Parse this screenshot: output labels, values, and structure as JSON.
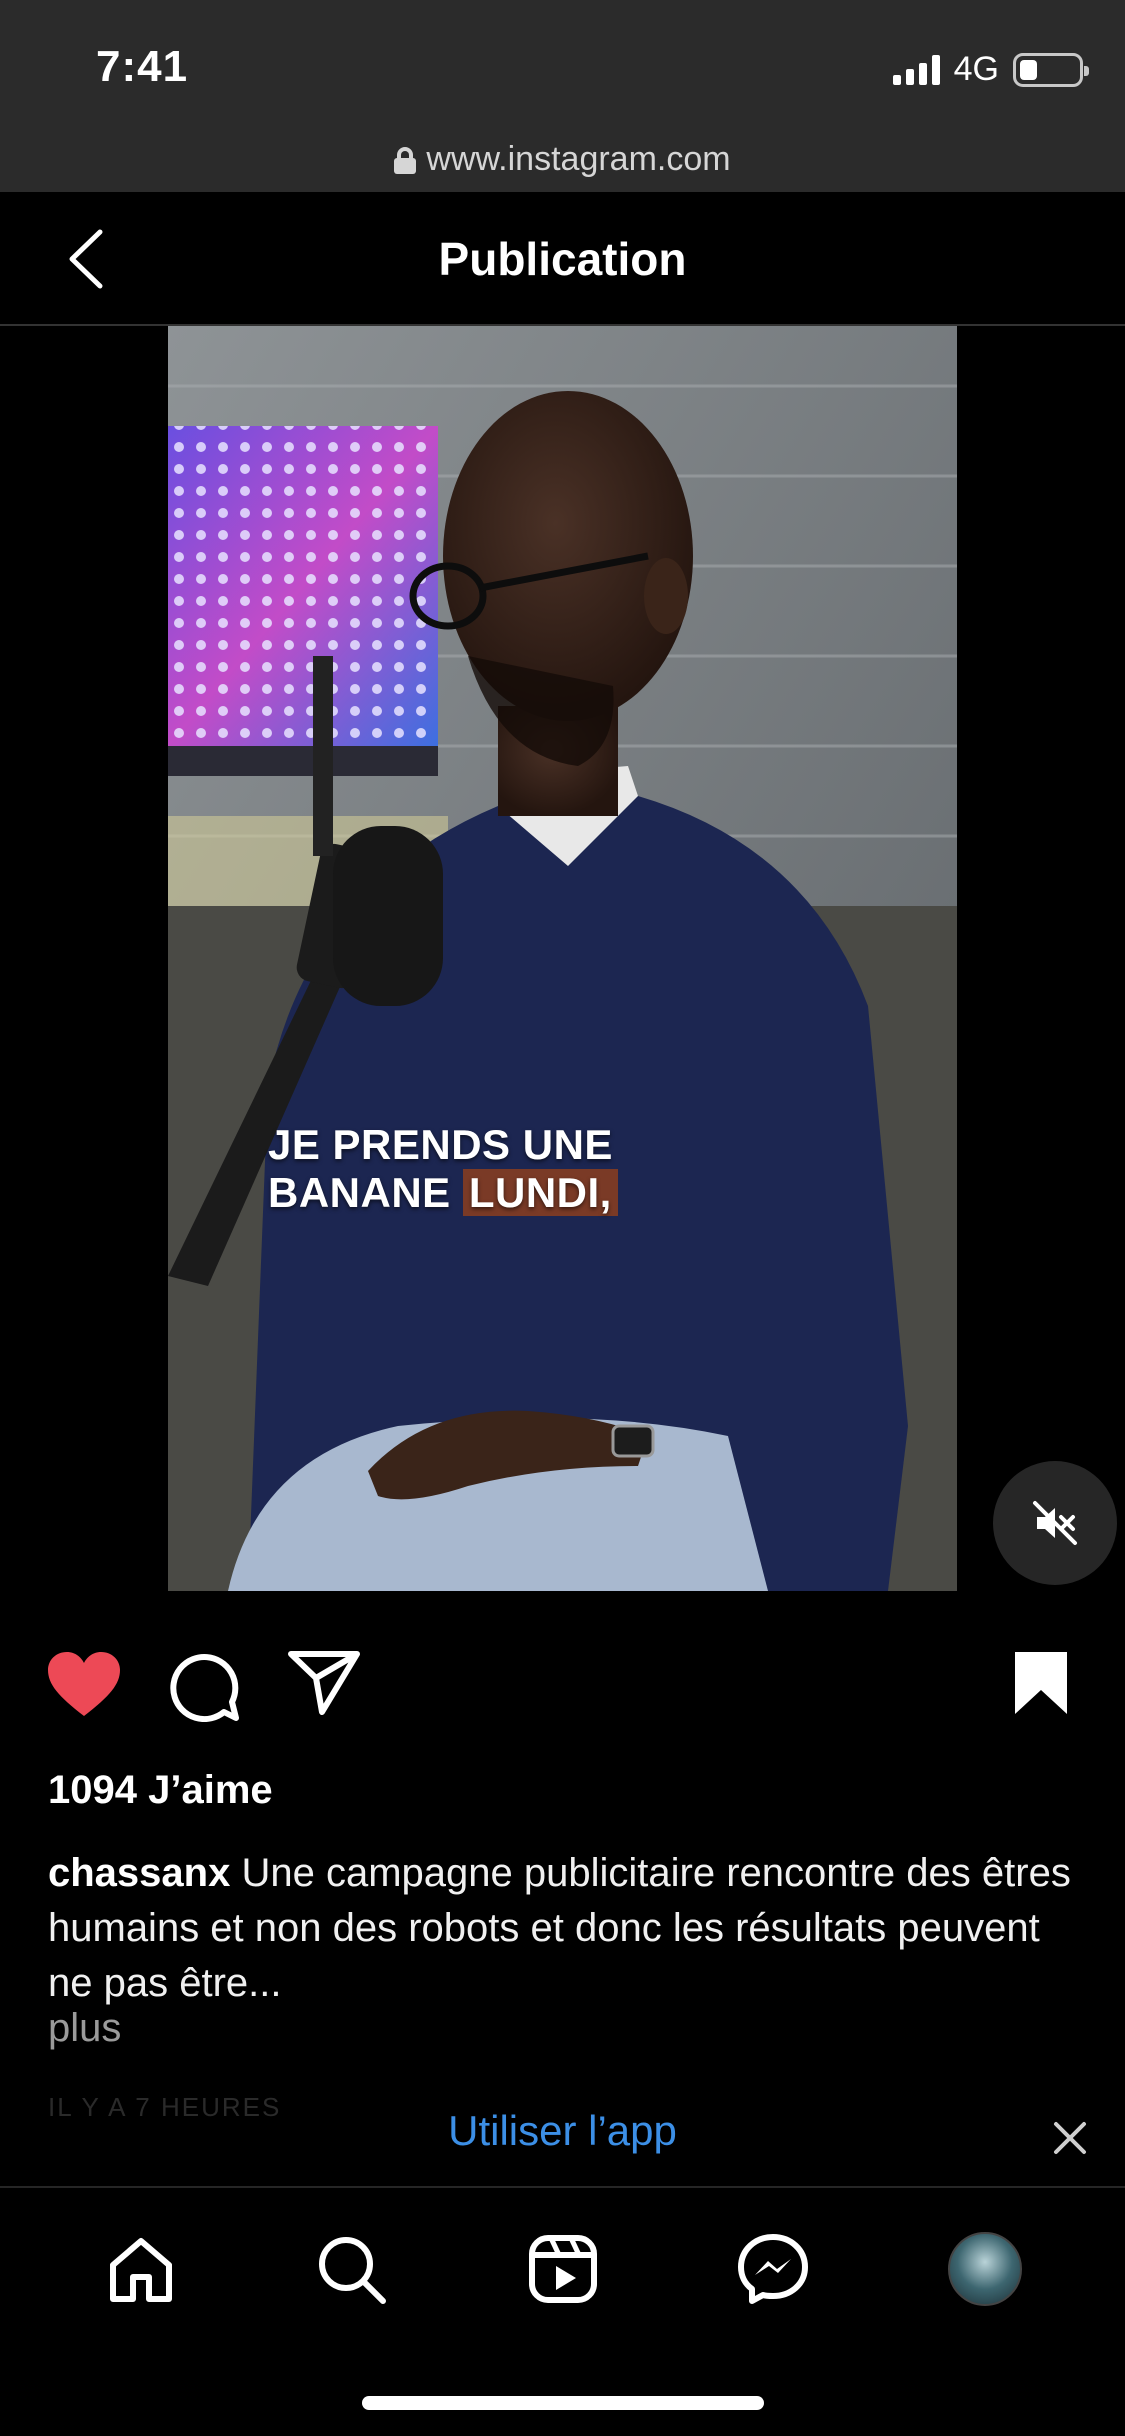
{
  "status_bar": {
    "time": "7:41",
    "network": "4G",
    "battery_level": 0.3
  },
  "browser": {
    "url": "www.instagram.com"
  },
  "header": {
    "title": "Publication"
  },
  "video": {
    "caption_line1": "JE PRENDS UNE",
    "caption_line2_a": "BANANE",
    "caption_line2_b": "LUNDI,",
    "muted": true
  },
  "post": {
    "liked": true,
    "likes_text": "1094 J’aime",
    "username": "chassanx",
    "caption": "Une campagne publicitaire rencontre des êtres humains et non des robots et donc les résultats peuvent ne pas être...",
    "more_label": "plus",
    "time_ago": "IL Y A 7 HEURES"
  },
  "app_banner": {
    "label": "Utiliser l’app"
  },
  "colors": {
    "like_red": "#ed4956",
    "link_blue": "#3c8fe6",
    "chrome_gray": "#2b2b2b"
  },
  "icons": {
    "like": "heart-icon",
    "comment": "comment-icon",
    "share": "send-icon",
    "save": "bookmark-icon",
    "mute": "speaker-muted-icon",
    "nav": [
      "home-icon",
      "search-icon",
      "reels-icon",
      "messenger-icon",
      "profile-avatar"
    ]
  }
}
